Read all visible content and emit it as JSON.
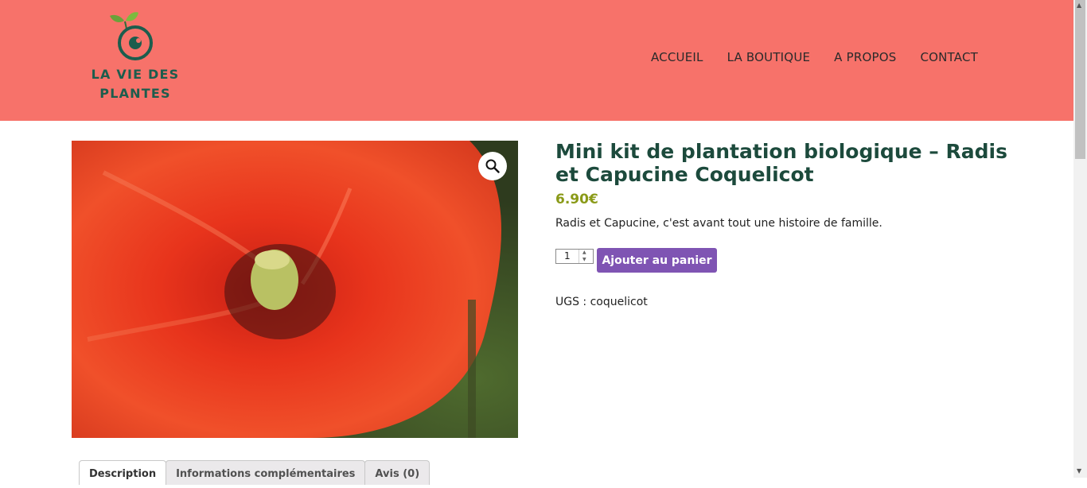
{
  "header": {
    "logo_text_line1": "LA VIE DES",
    "logo_text_line2": "PLANTES",
    "nav": [
      "ACCUEIL",
      "LA BOUTIQUE",
      "A PROPOS",
      "CONTACT"
    ]
  },
  "product": {
    "title": "Mini kit de plantation biologique – Radis et Capucine Coquelicot",
    "price": "6.90€",
    "short_description": "Radis et Capucine, c'est avant tout une histoire de famille.",
    "quantity": "1",
    "add_to_cart_label": "Ajouter au panier",
    "sku_line": "UGS : coquelicot"
  },
  "tabs": [
    "Description",
    "Informations complémentaires",
    "Avis (0)"
  ],
  "colors": {
    "header_bg": "#f7726a",
    "brand_green": "#1c4a3c",
    "price": "#8a9a18",
    "button": "#7f54b3"
  },
  "icons": [
    "zoom-icon",
    "logo-sprout-icon"
  ]
}
